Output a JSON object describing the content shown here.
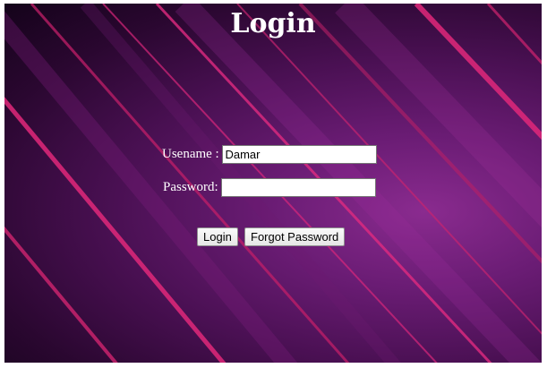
{
  "page": {
    "title": "Login"
  },
  "form": {
    "username_label": "Usename : ",
    "username_value": "Damar",
    "password_label": "Password: ",
    "password_value": "",
    "login_button": "Login",
    "forgot_button": "Forgot Password"
  },
  "colors": {
    "background_dark": "#14031a",
    "background_purple": "#8a2b8f",
    "stripe_pink": "#d1246f",
    "text": "#ffffff"
  }
}
